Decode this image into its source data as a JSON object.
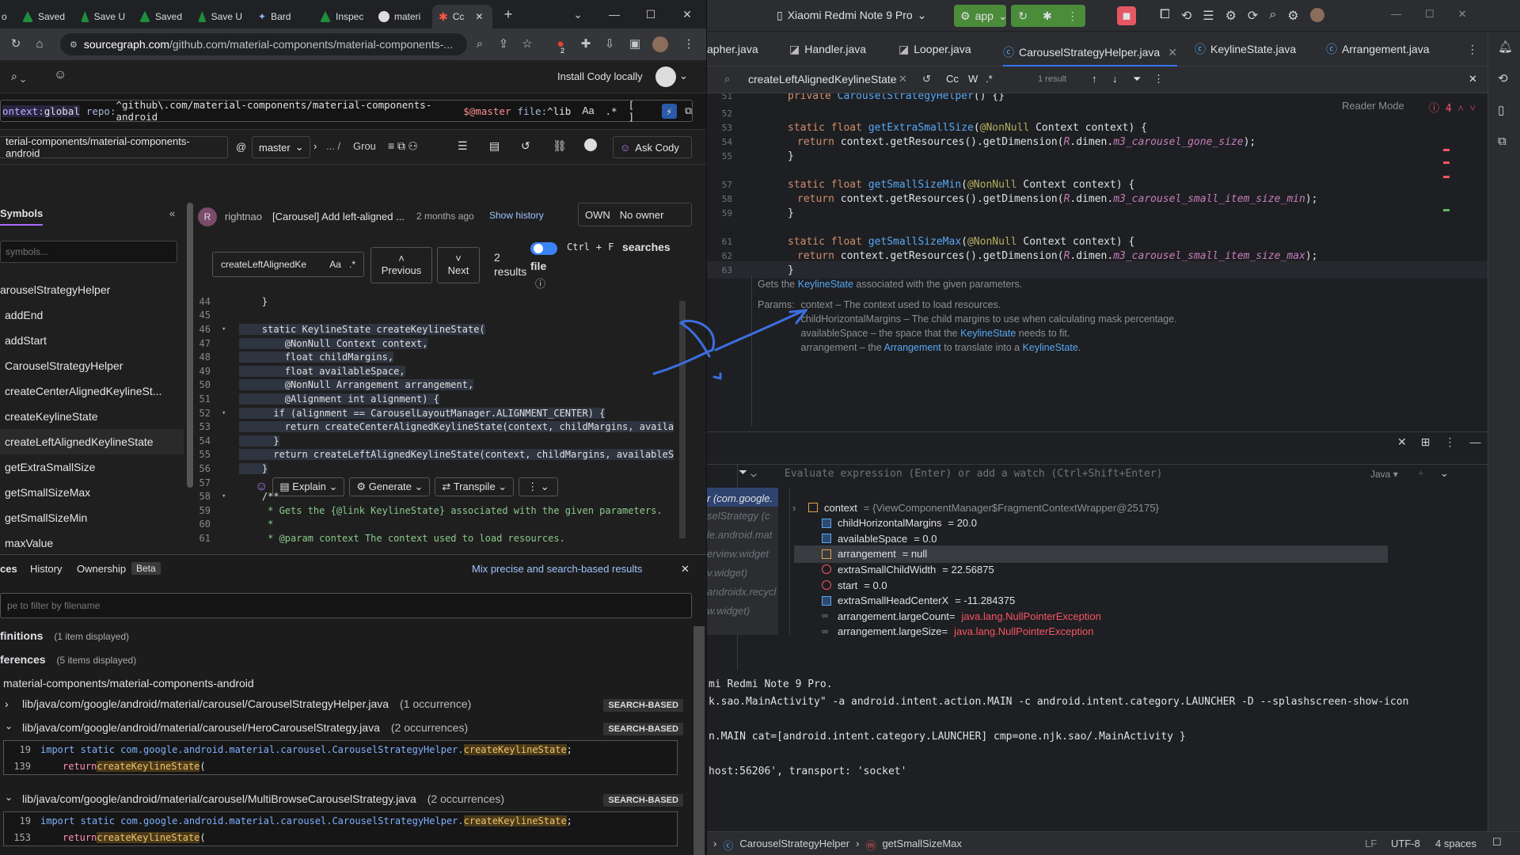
{
  "browser": {
    "tabs": [
      {
        "label": "Saved"
      },
      {
        "label": "Save U"
      },
      {
        "label": "Saved"
      },
      {
        "label": "Save U"
      },
      {
        "label": "Bard"
      },
      {
        "label": "Inspec"
      },
      {
        "label": "materi"
      },
      {
        "label": "Cc"
      }
    ],
    "url_host": "sourcegraph.com",
    "url_path": "/github.com/material-components/material-components-...",
    "ext_badge": "2"
  },
  "sourcegraph": {
    "install_cody": "Install Cody locally",
    "query": {
      "ctx_key": "ontext:",
      "ctx_val": "global",
      "repo_key": "repo:",
      "repo_val": "^github\\.com/material-components/material-components-android",
      "repo_rev": "$@master",
      "file_key": "file:",
      "file_val": "^lib",
      "aa": "Aa",
      "regex": ".*",
      "brackets": "[ ]"
    },
    "repo_name": "terial-components/material-components-android",
    "at": "@",
    "branch": "master",
    "path_sep": "...  /",
    "path_tail": "Grou",
    "ask_cody": "Ask Cody",
    "symbols_title": "Symbols",
    "symbols_placeholder": "symbols...",
    "symbols": [
      "arouselStrategyHelper",
      "addEnd",
      "addStart",
      "CarouselStrategyHelper",
      "createCenterAlignedKeylineSt...",
      "createKeylineState",
      "createLeftAlignedKeylineState",
      "getExtraSmallSize",
      "getSmallSizeMax",
      "getSmallSizeMin",
      "maxValue"
    ],
    "commit_avatar": "R",
    "commit_author": "rightnao",
    "commit_msg": "[Carousel] Add left-aligned ...",
    "commit_age": "2 months ago",
    "show_history": "Show history",
    "own": "OWN",
    "no_owner": "No owner",
    "find_input": "createLeftAlignedKe",
    "find_aa": "Aa",
    "find_regex": ".*",
    "prev": "Previous",
    "next": "Next",
    "results_count": "2",
    "results_label": "results",
    "ctrl": "Ctrl",
    "plus": "+",
    "fkey": "F",
    "searches_file": "searches",
    "file_word": "file",
    "code_lines": [
      {
        "n": "44",
        "t": "    }"
      },
      {
        "n": "45",
        "t": ""
      },
      {
        "n": "46",
        "t": "    static KeylineState createKeylineState("
      },
      {
        "n": "47",
        "t": "        @NonNull Context context,"
      },
      {
        "n": "48",
        "t": "        float childMargins,"
      },
      {
        "n": "49",
        "t": "        float availableSpace,"
      },
      {
        "n": "50",
        "t": "        @NonNull Arrangement arrangement,"
      },
      {
        "n": "51",
        "t": "        @Alignment int alignment) {"
      },
      {
        "n": "52",
        "t": "      if (alignment == CarouselLayoutManager.ALIGNMENT_CENTER) {"
      },
      {
        "n": "53",
        "t": "        return createCenterAlignedKeylineState(context, childMargins, availa"
      },
      {
        "n": "54",
        "t": "      }"
      },
      {
        "n": "55",
        "t": "      return createLeftAlignedKeylineState(context, childMargins, availableS"
      },
      {
        "n": "56",
        "t": "    }"
      },
      {
        "n": "57",
        "t": ""
      },
      {
        "n": "58",
        "t": "    /**"
      },
      {
        "n": "59",
        "t": "     * Gets the {@link KeylineState} associated with the given parameters."
      },
      {
        "n": "60",
        "t": "     *"
      },
      {
        "n": "61",
        "t": "     * @param context The context used to load resources."
      }
    ],
    "cody_actions": [
      "Explain",
      "Generate",
      "Transpile"
    ],
    "refs_tabs": [
      "ces",
      "History",
      "Ownership"
    ],
    "beta": "Beta",
    "mix": "Mix precise and search-based results",
    "filter_placeholder": "pe to filter by filename",
    "definitions": "finitions",
    "definitions_count": "(1 item displayed)",
    "references": "ferences",
    "references_count": "(5 items displayed)",
    "ref_repo": "material-components/material-components-android",
    "ref_files": [
      {
        "path": "lib/java/com/google/android/material/carousel/CarouselStrategyHelper.java",
        "count": "(1 occurrence)",
        "badge": "SEARCH-BASED"
      },
      {
        "path": "lib/java/com/google/android/material/carousel/HeroCarouselStrategy.java",
        "count": "(2 occurrences)",
        "badge": "SEARCH-BASED"
      },
      {
        "path": "lib/java/com/google/android/material/carousel/MultiBrowseCarouselStrategy.java",
        "count": "(2 occurrences)",
        "badge": "SEARCH-BASED"
      }
    ],
    "snip_import_pre": "import static com.google.android.material.carousel.CarouselStrategyHelper.",
    "snip_hit": "createKeylineState",
    "snip_semicolon": ";",
    "snip_return": "return ",
    "snip_paren": "(",
    "snip1_n1": "19",
    "snip1_n2": "139",
    "snip2_n1": "19",
    "snip2_n2": "153"
  },
  "ide": {
    "device": "Xiaomi Redmi Note 9 Pro",
    "run_config": "app",
    "tabs": [
      "apher.java",
      "Handler.java",
      "Looper.java",
      "CarouselStrategyHelper.java",
      "KeylineState.java",
      "Arrangement.java"
    ],
    "find_text": "createLeftAlignedKeylineState",
    "find_cc": "Cc",
    "find_w": "W",
    "find_regex": ".*",
    "find_results": "1 result",
    "reader_mode": "Reader Mode",
    "problems": "4",
    "editor_lines": [
      {
        "n": "51"
      },
      {
        "n": "52"
      },
      {
        "n": "53"
      },
      {
        "n": "54"
      },
      {
        "n": "55"
      },
      {
        "n": "56"
      },
      {
        "n": "57"
      },
      {
        "n": "58"
      },
      {
        "n": "59"
      },
      {
        "n": "60"
      },
      {
        "n": "61"
      },
      {
        "n": "62"
      },
      {
        "n": "63"
      }
    ],
    "code": {
      "private": "private ",
      "ctor": "CarouselStrategyHelper",
      "ctor_tail": "() {}",
      "static_float": "static float ",
      "f1": "getExtraSmallSize",
      "f2": "getSmallSizeMin",
      "f3": "getSmallSizeMax",
      "nonnull": "@NonNull",
      "params": " Context context) {",
      "ret": "return ",
      "ctx_call": "context.getResources().getDimension(",
      "r": "R",
      "dimen": ".dimen.",
      "d1": "m3_carousel_gone_size",
      "d2": "m3_carousel_small_item_size_min",
      "d3": "m3_carousel_small_item_size_max",
      "close_call": ");",
      "brace": "}"
    },
    "doc": {
      "summary_pre": "Gets the ",
      "summary_link": "KeylineState",
      "summary_post": " associated with the given parameters.",
      "params_label": "Params:",
      "p1": "context – The context used to load resources.",
      "p2": "childHorizontalMargins – The child margins to use when calculating mask percentage.",
      "p3_pre": "availableSpace – the space that the ",
      "p3_link": "KeylineState",
      "p3_post": " needs to fit.",
      "p4_pre": "arrangement – the ",
      "p4_link": "Arrangement",
      "p4_mid": " to translate into a ",
      "p4_link2": "KeylineState",
      "p4_post": "."
    },
    "frames": [
      "r (com.google.",
      "selStrategy (c",
      "le.android.mat",
      "erview.widget",
      "v.widget)",
      "androidx.recycl",
      "w.widget)"
    ],
    "eval_placeholder": "Evaluate expression (Enter) or add a watch (Ctrl+Shift+Enter)",
    "eval_lang": "Java",
    "variables": [
      {
        "name": "context",
        "value": " = {ViewComponentManager$FragmentContextWrapper@25175}",
        "kind": "obj",
        "expand": true
      },
      {
        "name": "childHorizontalMargins",
        "value": " = 20.0",
        "kind": "prim"
      },
      {
        "name": "availableSpace",
        "value": " = 0.0",
        "kind": "prim"
      },
      {
        "name": "arrangement",
        "value": " = null",
        "kind": "obj",
        "selected": true
      },
      {
        "name": "extraSmallChildWidth",
        "value": " = 22.56875",
        "kind": "field"
      },
      {
        "name": "start",
        "value": " = 0.0",
        "kind": "field"
      },
      {
        "name": "extraSmallHeadCenterX",
        "value": " = -11.284375",
        "kind": "prim"
      },
      {
        "name": "arrangement.largeCount",
        "value": "java.lang.NullPointerException",
        "kind": "watch",
        "error": true
      },
      {
        "name": "arrangement.largeSize",
        "value": "java.lang.NullPointerException",
        "kind": "watch",
        "error": true
      }
    ],
    "console": [
      "mi Redmi Note 9 Pro.",
      "k.sao.MainActivity\" -a android.intent.action.MAIN -c android.intent.category.LAUNCHER -D --splashscreen-show-icon",
      "",
      "n.MAIN cat=[android.intent.category.LAUNCHER] cmp=one.njk.sao/.MainActivity }",
      "",
      "host:56206', transport: 'socket'"
    ],
    "status": {
      "crumb1": "CarouselStrategyHelper",
      "crumb2": "getSmallSizeMax",
      "lf": "LF",
      "enc": "UTF-8",
      "indent": "4 spaces"
    },
    "colors": {
      "accent": "#3574f0",
      "run_green": "#4b8c3b",
      "error": "#f75464"
    }
  }
}
